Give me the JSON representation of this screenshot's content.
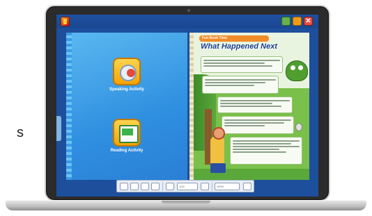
{
  "stray_text": "s",
  "left_page": {
    "activities": [
      {
        "label": "Speaking Activity",
        "icon": "speaking-activity-icon"
      },
      {
        "label": "Reading Activity",
        "icon": "reading-activity-icon"
      }
    ]
  },
  "right_page": {
    "title_bar": "Fun Book Time",
    "title": "What Happened Next"
  },
  "colors": {
    "screen_bg": "#1d4f9c",
    "left_page": "#2f8fe0",
    "right_page": "#7ac04a",
    "activity_icon": "#f5a300"
  },
  "toolbar": {
    "page_field": "1/24",
    "zoom_field": "100%"
  },
  "titlebar": {
    "close_label": "✕"
  }
}
